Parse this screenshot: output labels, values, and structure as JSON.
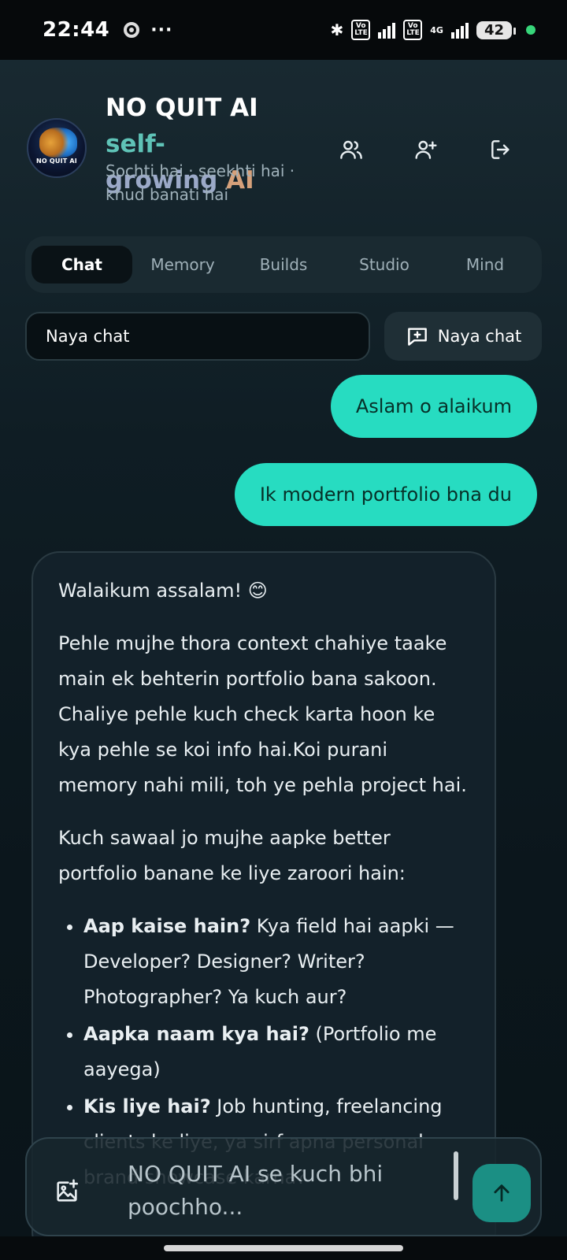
{
  "status_bar": {
    "time": "22:44",
    "dots": "···",
    "bluetooth": "✱",
    "volte1": "Vo LTE",
    "volte2": "Vo LTE",
    "network": "4G",
    "battery": "42"
  },
  "header": {
    "title_part1": "NO QUIT AI ",
    "title_part2": "self-",
    "title_part3": "growing ",
    "title_part4": "AI",
    "subtitle": "Sochti hai · seekhti hai · khud banati hai",
    "logo_text": "NO QUIT AI"
  },
  "icons": {
    "users": "users-icon",
    "add_user": "add-user-icon",
    "logout": "logout-icon",
    "new_chat": "message-plus-icon",
    "image_add": "image-add-icon",
    "send": "arrow-up-icon"
  },
  "tabs": [
    {
      "label": "Chat",
      "active": true
    },
    {
      "label": "Memory",
      "active": false
    },
    {
      "label": "Builds",
      "active": false
    },
    {
      "label": "Studio",
      "active": false
    },
    {
      "label": "Mind",
      "active": false
    }
  ],
  "chat_selector": {
    "current": "Naya chat",
    "new_chat_label": "Naya chat"
  },
  "messages": {
    "user1": "Aslam o alaikum",
    "user2": "Ik modern portfolio bna du",
    "ai": {
      "greeting": "Walaikum assalam! 😊",
      "para1": "Pehle mujhe thora context chahiye taake main ek behterin portfolio bana sakoon. Chaliye pehle kuch check karta hoon ke kya pehle se koi info hai.Koi purani memory nahi mili, toh ye pehla project hai.",
      "para2": "Kuch sawaal jo mujhe aapke better portfolio banane ke liye zaroori hain:",
      "bullets": [
        {
          "bold": "Aap kaise hain?",
          "text": " Kya field hai aapki — Developer? Designer? Writer? Photographer? Ya kuch aur?"
        },
        {
          "bold": "Aapka naam kya hai?",
          "text": " (Portfolio me aayega)"
        },
        {
          "bold": "Kis liye hai?",
          "text": " Job hunting, freelancing clients ke liye, ya sirf apna personal brand showcase karna?"
        }
      ]
    }
  },
  "composer": {
    "placeholder": "NO QUIT AI se kuch bhi poochho..."
  },
  "colors": {
    "accent": "#27dcc1",
    "send_button": "#1b8f84",
    "background": "#0f1d24"
  }
}
